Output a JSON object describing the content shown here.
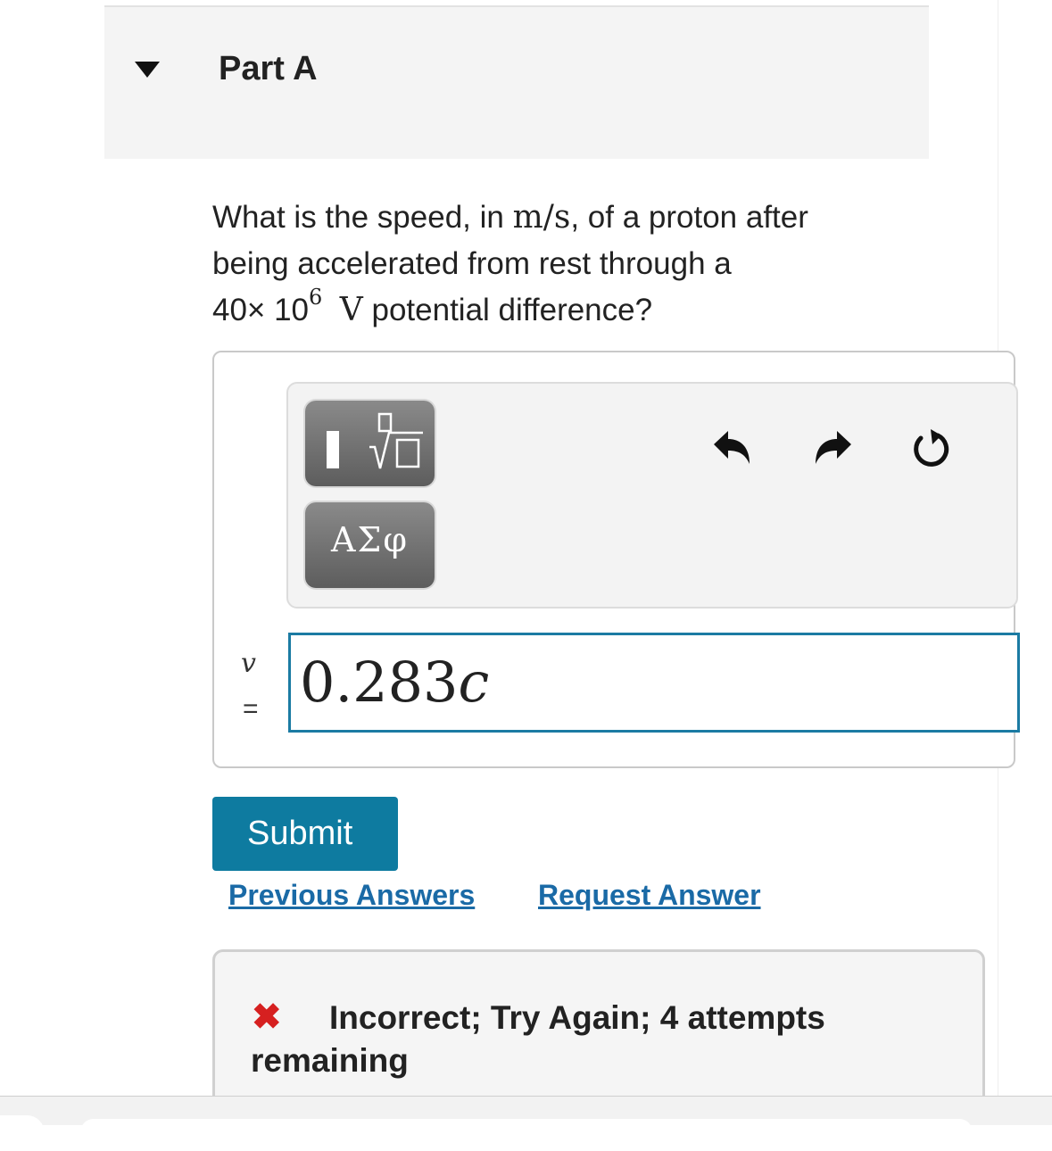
{
  "part": {
    "title": "Part A"
  },
  "question": {
    "prefix": "What is the speed, in ",
    "unit_m": "m",
    "unit_slash": "/",
    "unit_s": "s",
    "line1_rest": ", of a proton after",
    "line2": "being accelerated from rest through a",
    "coeff": "40× 10",
    "exponent": "6",
    "volt_unit": "V",
    "line3_rest": " potential difference?"
  },
  "toolbar": {
    "greek_label": "ΑΣφ"
  },
  "answer": {
    "variable": "v",
    "equals": "=",
    "number": "0.283",
    "symbol": "c"
  },
  "actions": {
    "submit_label": "Submit",
    "previous_answers_label": "Previous Answers",
    "request_answer_label": "Request Answer"
  },
  "feedback": {
    "mark": "✖",
    "text": "Incorrect; Try Again; 4 attempts remaining"
  },
  "colors": {
    "accent": "#0e7ba0",
    "link": "#1a6aa6",
    "error": "#d62020"
  }
}
